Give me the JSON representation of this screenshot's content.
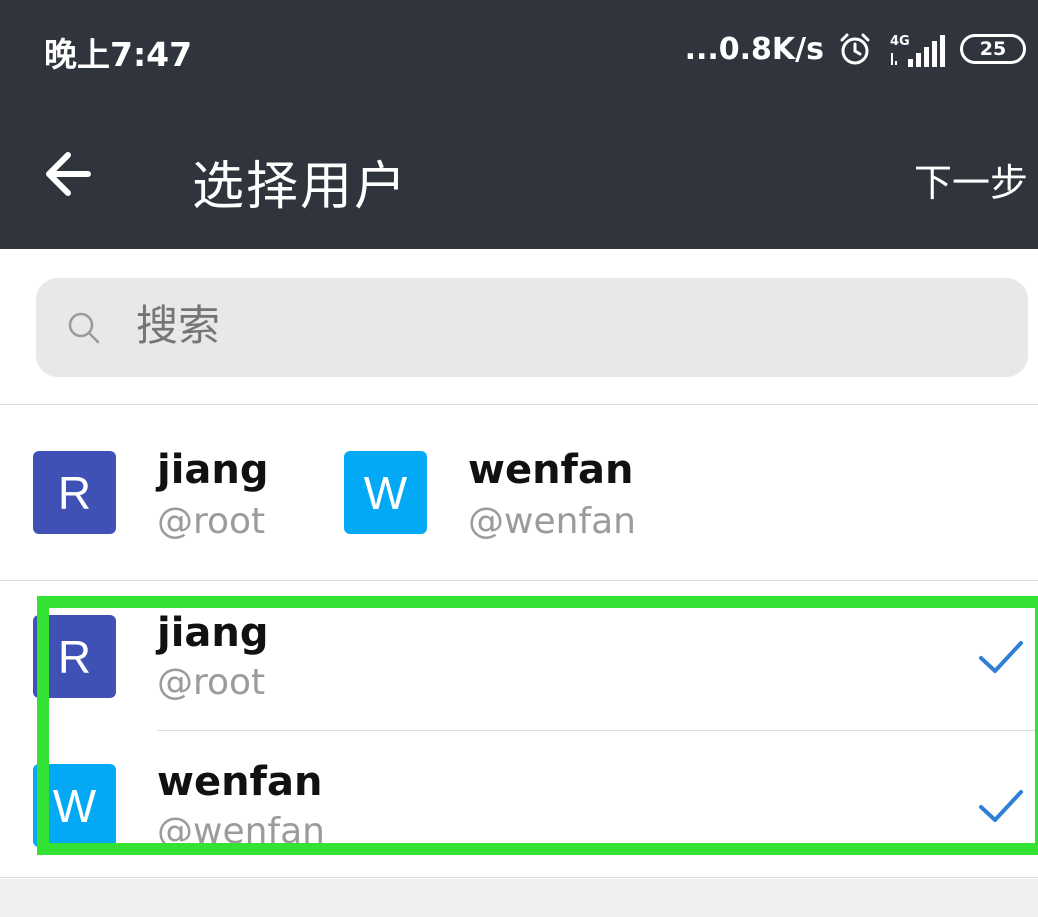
{
  "status_bar": {
    "time": "晚上7:47",
    "network_speed": "...0.8K/s",
    "alarm_icon": "alarm-clock-icon",
    "signal_label": "4G",
    "battery": "25"
  },
  "app_bar": {
    "back_icon": "arrow-left-icon",
    "title": "选择用户",
    "next_label": "下一步"
  },
  "search": {
    "icon": "search-icon",
    "placeholder": "搜索"
  },
  "selected_chips": [
    {
      "initial": "R",
      "name": "jiang",
      "handle": "@root",
      "color": "#3f51b5"
    },
    {
      "initial": "W",
      "name": "wenfan",
      "handle": "@wenfan",
      "color": "#03a9f4"
    }
  ],
  "users": [
    {
      "initial": "R",
      "name": "jiang",
      "handle": "@root",
      "color": "#3f51b5",
      "checked": true
    },
    {
      "initial": "W",
      "name": "wenfan",
      "handle": "@wenfan",
      "color": "#03a9f4",
      "checked": true
    }
  ],
  "colors": {
    "bar": "#30343d",
    "check": "#2f7fd6",
    "highlight": "#33e233"
  }
}
